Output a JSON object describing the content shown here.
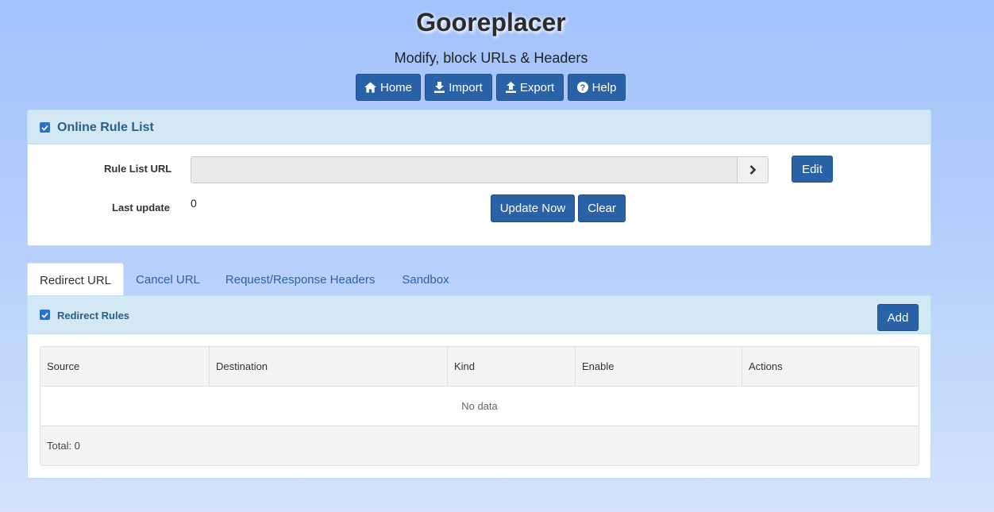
{
  "app": {
    "title": "Gooreplacer",
    "subtitle": "Modify, block URLs & Headers"
  },
  "nav": {
    "home": "Home",
    "import": "Import",
    "export": "Export",
    "help": "Help"
  },
  "online_rule_list": {
    "title": "Online Rule List",
    "enabled": true,
    "rule_list_url_label": "Rule List URL",
    "rule_list_url_value": "",
    "edit_label": "Edit",
    "last_update_label": "Last update",
    "last_update_value": "0",
    "update_now_label": "Update Now",
    "clear_label": "Clear"
  },
  "tabs": [
    "Redirect URL",
    "Cancel URL",
    "Request/Response Headers",
    "Sandbox"
  ],
  "active_tab": "Redirect URL",
  "redirect_rules": {
    "title": "Redirect Rules",
    "enabled": true,
    "add_label": "Add",
    "columns": [
      "Source",
      "Destination",
      "Kind",
      "Enable",
      "Actions"
    ],
    "rows": [],
    "empty_text": "No data",
    "total_text": "Total: 0"
  },
  "colors": {
    "primary_button": "#2a62a8",
    "panel_header": "#d3e7f4",
    "panel_title": "#2b5f88",
    "link": "#2a62a8"
  },
  "icons": {
    "home": "home-icon",
    "import": "import-icon",
    "export": "export-icon",
    "help": "question-circle-icon",
    "go": "chevron-right-icon",
    "checkbox": "checkbox-checked-icon"
  }
}
